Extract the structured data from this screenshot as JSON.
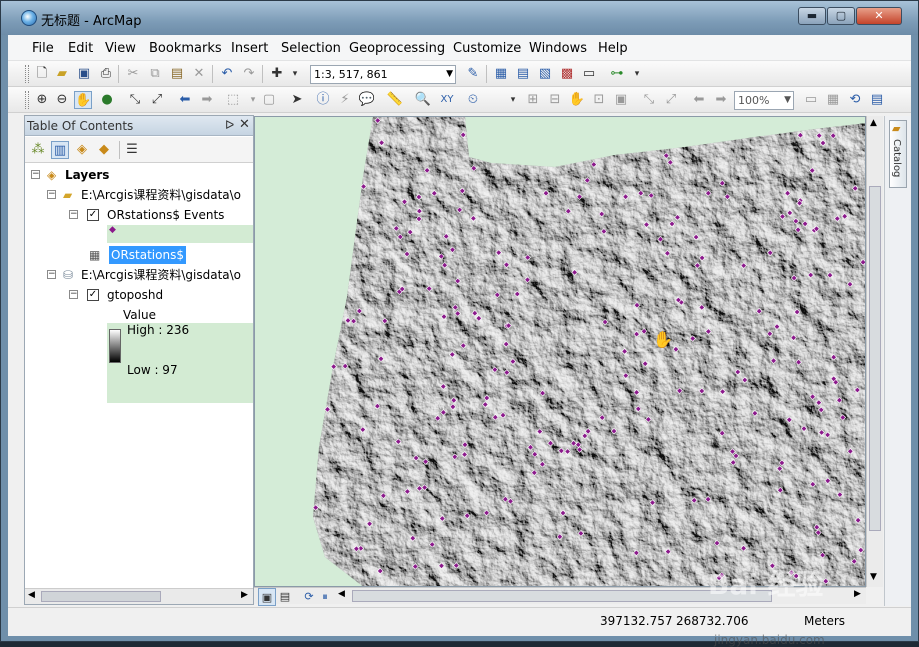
{
  "window": {
    "title": "无标题 - ArcMap",
    "min_glyph": "▬",
    "max_glyph": "▢",
    "close_glyph": "✕"
  },
  "menu": [
    "File",
    "Edit",
    "View",
    "Bookmarks",
    "Insert",
    "Selection",
    "Geoprocessing",
    "Customize",
    "Windows",
    "Help"
  ],
  "toolbar": {
    "scale": "1:3, 517, 861",
    "zoom": "100%"
  },
  "toc": {
    "title": "Table Of Contents",
    "pin_glyph": "ᐅ",
    "close_glyph": "✕",
    "layers_label": "Layers",
    "folder1_path": "E:\\Arcgis课程资料\\gisdata\\o",
    "events_layer": "ORstations$ Events",
    "table_name": "ORstations$",
    "folder2_path": "E:\\Arcgis课程资料\\gisdata\\o",
    "raster_layer": "gtoposhd",
    "legend_value": "Value",
    "legend_high": "High : 236",
    "legend_low": "Low : 97"
  },
  "catalog": {
    "label": "Catalog"
  },
  "statusbar": {
    "x": "397132.757",
    "y": "268732.706",
    "unit": "Meters"
  },
  "watermark": {
    "main": "Bai 经验",
    "sub": "jingyan.baidu.com"
  },
  "colors": {
    "map_background": "#d4ecd7",
    "station_point": "#8b1a8b",
    "selection_highlight": "#3399ff"
  }
}
